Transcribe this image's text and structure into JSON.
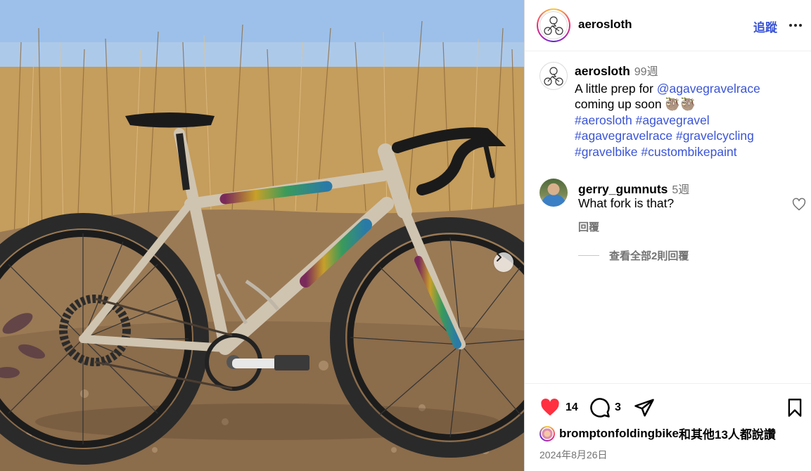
{
  "post": {
    "username": "aerosloth",
    "follow_label": "追蹤",
    "more_icon": "more-horizontal-icon"
  },
  "caption": {
    "username": "aerosloth",
    "time": "99週",
    "text_before": "A little prep for ",
    "mention": "@agavegravelrace",
    "text_after": " coming up soon 🦥🦥",
    "hashtags": [
      "#aerosloth",
      "#agavegravel",
      "#agavegravelrace",
      "#gravelcycling",
      "#gravelbike",
      "#custombikepaint"
    ]
  },
  "comments": [
    {
      "username": "gerry_gumnuts",
      "time": "5週",
      "text": "What fork is that?",
      "reply_label": "回覆"
    }
  ],
  "view_replies_label": "查看全部2則回覆",
  "actions": {
    "like_count": "14",
    "comment_count": "3",
    "liked": true,
    "like_color": "#ff3040"
  },
  "likes": {
    "liker": "bromptonfoldingbike",
    "suffix": "和其他13人都說讚"
  },
  "date": "2024年8月26日",
  "colors": {
    "link": "#3a54d6",
    "muted": "#737373"
  }
}
